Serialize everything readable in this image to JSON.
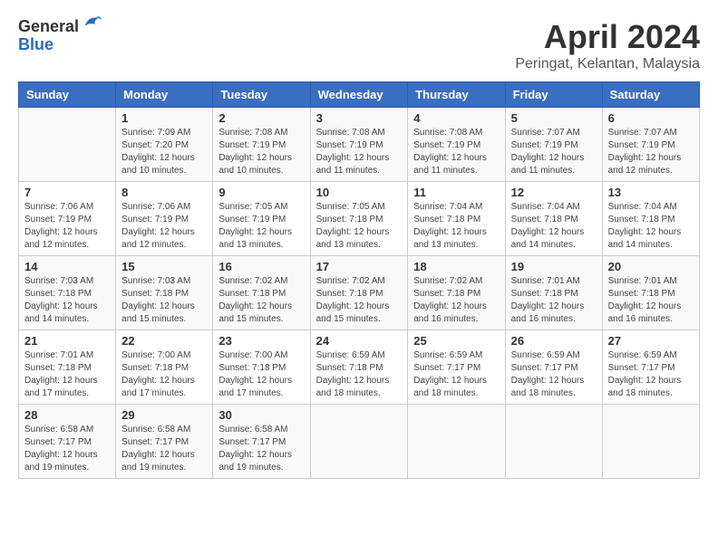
{
  "logo": {
    "general": "General",
    "blue": "Blue"
  },
  "title": "April 2024",
  "location": "Peringat, Kelantan, Malaysia",
  "headers": [
    "Sunday",
    "Monday",
    "Tuesday",
    "Wednesday",
    "Thursday",
    "Friday",
    "Saturday"
  ],
  "weeks": [
    [
      {
        "day": "",
        "info": ""
      },
      {
        "day": "1",
        "info": "Sunrise: 7:09 AM\nSunset: 7:20 PM\nDaylight: 12 hours\nand 10 minutes."
      },
      {
        "day": "2",
        "info": "Sunrise: 7:08 AM\nSunset: 7:19 PM\nDaylight: 12 hours\nand 10 minutes."
      },
      {
        "day": "3",
        "info": "Sunrise: 7:08 AM\nSunset: 7:19 PM\nDaylight: 12 hours\nand 11 minutes."
      },
      {
        "day": "4",
        "info": "Sunrise: 7:08 AM\nSunset: 7:19 PM\nDaylight: 12 hours\nand 11 minutes."
      },
      {
        "day": "5",
        "info": "Sunrise: 7:07 AM\nSunset: 7:19 PM\nDaylight: 12 hours\nand 11 minutes."
      },
      {
        "day": "6",
        "info": "Sunrise: 7:07 AM\nSunset: 7:19 PM\nDaylight: 12 hours\nand 12 minutes."
      }
    ],
    [
      {
        "day": "7",
        "info": "Sunrise: 7:06 AM\nSunset: 7:19 PM\nDaylight: 12 hours\nand 12 minutes."
      },
      {
        "day": "8",
        "info": "Sunrise: 7:06 AM\nSunset: 7:19 PM\nDaylight: 12 hours\nand 12 minutes."
      },
      {
        "day": "9",
        "info": "Sunrise: 7:05 AM\nSunset: 7:19 PM\nDaylight: 12 hours\nand 13 minutes."
      },
      {
        "day": "10",
        "info": "Sunrise: 7:05 AM\nSunset: 7:18 PM\nDaylight: 12 hours\nand 13 minutes."
      },
      {
        "day": "11",
        "info": "Sunrise: 7:04 AM\nSunset: 7:18 PM\nDaylight: 12 hours\nand 13 minutes."
      },
      {
        "day": "12",
        "info": "Sunrise: 7:04 AM\nSunset: 7:18 PM\nDaylight: 12 hours\nand 14 minutes."
      },
      {
        "day": "13",
        "info": "Sunrise: 7:04 AM\nSunset: 7:18 PM\nDaylight: 12 hours\nand 14 minutes."
      }
    ],
    [
      {
        "day": "14",
        "info": "Sunrise: 7:03 AM\nSunset: 7:18 PM\nDaylight: 12 hours\nand 14 minutes."
      },
      {
        "day": "15",
        "info": "Sunrise: 7:03 AM\nSunset: 7:18 PM\nDaylight: 12 hours\nand 15 minutes."
      },
      {
        "day": "16",
        "info": "Sunrise: 7:02 AM\nSunset: 7:18 PM\nDaylight: 12 hours\nand 15 minutes."
      },
      {
        "day": "17",
        "info": "Sunrise: 7:02 AM\nSunset: 7:18 PM\nDaylight: 12 hours\nand 15 minutes."
      },
      {
        "day": "18",
        "info": "Sunrise: 7:02 AM\nSunset: 7:18 PM\nDaylight: 12 hours\nand 16 minutes."
      },
      {
        "day": "19",
        "info": "Sunrise: 7:01 AM\nSunset: 7:18 PM\nDaylight: 12 hours\nand 16 minutes."
      },
      {
        "day": "20",
        "info": "Sunrise: 7:01 AM\nSunset: 7:18 PM\nDaylight: 12 hours\nand 16 minutes."
      }
    ],
    [
      {
        "day": "21",
        "info": "Sunrise: 7:01 AM\nSunset: 7:18 PM\nDaylight: 12 hours\nand 17 minutes."
      },
      {
        "day": "22",
        "info": "Sunrise: 7:00 AM\nSunset: 7:18 PM\nDaylight: 12 hours\nand 17 minutes."
      },
      {
        "day": "23",
        "info": "Sunrise: 7:00 AM\nSunset: 7:18 PM\nDaylight: 12 hours\nand 17 minutes."
      },
      {
        "day": "24",
        "info": "Sunrise: 6:59 AM\nSunset: 7:18 PM\nDaylight: 12 hours\nand 18 minutes."
      },
      {
        "day": "25",
        "info": "Sunrise: 6:59 AM\nSunset: 7:17 PM\nDaylight: 12 hours\nand 18 minutes."
      },
      {
        "day": "26",
        "info": "Sunrise: 6:59 AM\nSunset: 7:17 PM\nDaylight: 12 hours\nand 18 minutes."
      },
      {
        "day": "27",
        "info": "Sunrise: 6:59 AM\nSunset: 7:17 PM\nDaylight: 12 hours\nand 18 minutes."
      }
    ],
    [
      {
        "day": "28",
        "info": "Sunrise: 6:58 AM\nSunset: 7:17 PM\nDaylight: 12 hours\nand 19 minutes."
      },
      {
        "day": "29",
        "info": "Sunrise: 6:58 AM\nSunset: 7:17 PM\nDaylight: 12 hours\nand 19 minutes."
      },
      {
        "day": "30",
        "info": "Sunrise: 6:58 AM\nSunset: 7:17 PM\nDaylight: 12 hours\nand 19 minutes."
      },
      {
        "day": "",
        "info": ""
      },
      {
        "day": "",
        "info": ""
      },
      {
        "day": "",
        "info": ""
      },
      {
        "day": "",
        "info": ""
      }
    ]
  ]
}
